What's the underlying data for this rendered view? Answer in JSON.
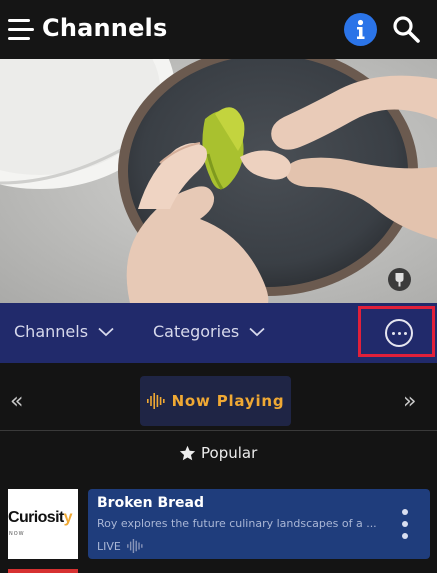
{
  "header": {
    "title": "Channels"
  },
  "navbar": {
    "channels_label": "Channels",
    "categories_label": "Categories"
  },
  "now_playing": {
    "label": "Now Playing",
    "prev_label": "«",
    "next_label": "»"
  },
  "section": {
    "label": "Popular"
  },
  "channel_row": {
    "logo_text": "Curiosit",
    "logo_accent": "y",
    "logo_sub": "NOW",
    "title": "Broken Bread",
    "description": "Roy explores the future culinary landscapes of a ...",
    "status": "LIVE"
  },
  "colors": {
    "header_bg": "#151515",
    "navbar_bg": "#212a6b",
    "info_blue": "#2b74e8",
    "accent_orange": "#f0a934",
    "card_bg": "#1f3d7c",
    "highlight_red": "#e1203a"
  },
  "icons": {
    "menu": "hamburger-icon",
    "info": "info-icon",
    "search": "search-icon",
    "more": "more-horizontal-icon",
    "equalizer": "equalizer-icon",
    "star": "star-icon",
    "kebab": "vertical-dots-icon"
  }
}
